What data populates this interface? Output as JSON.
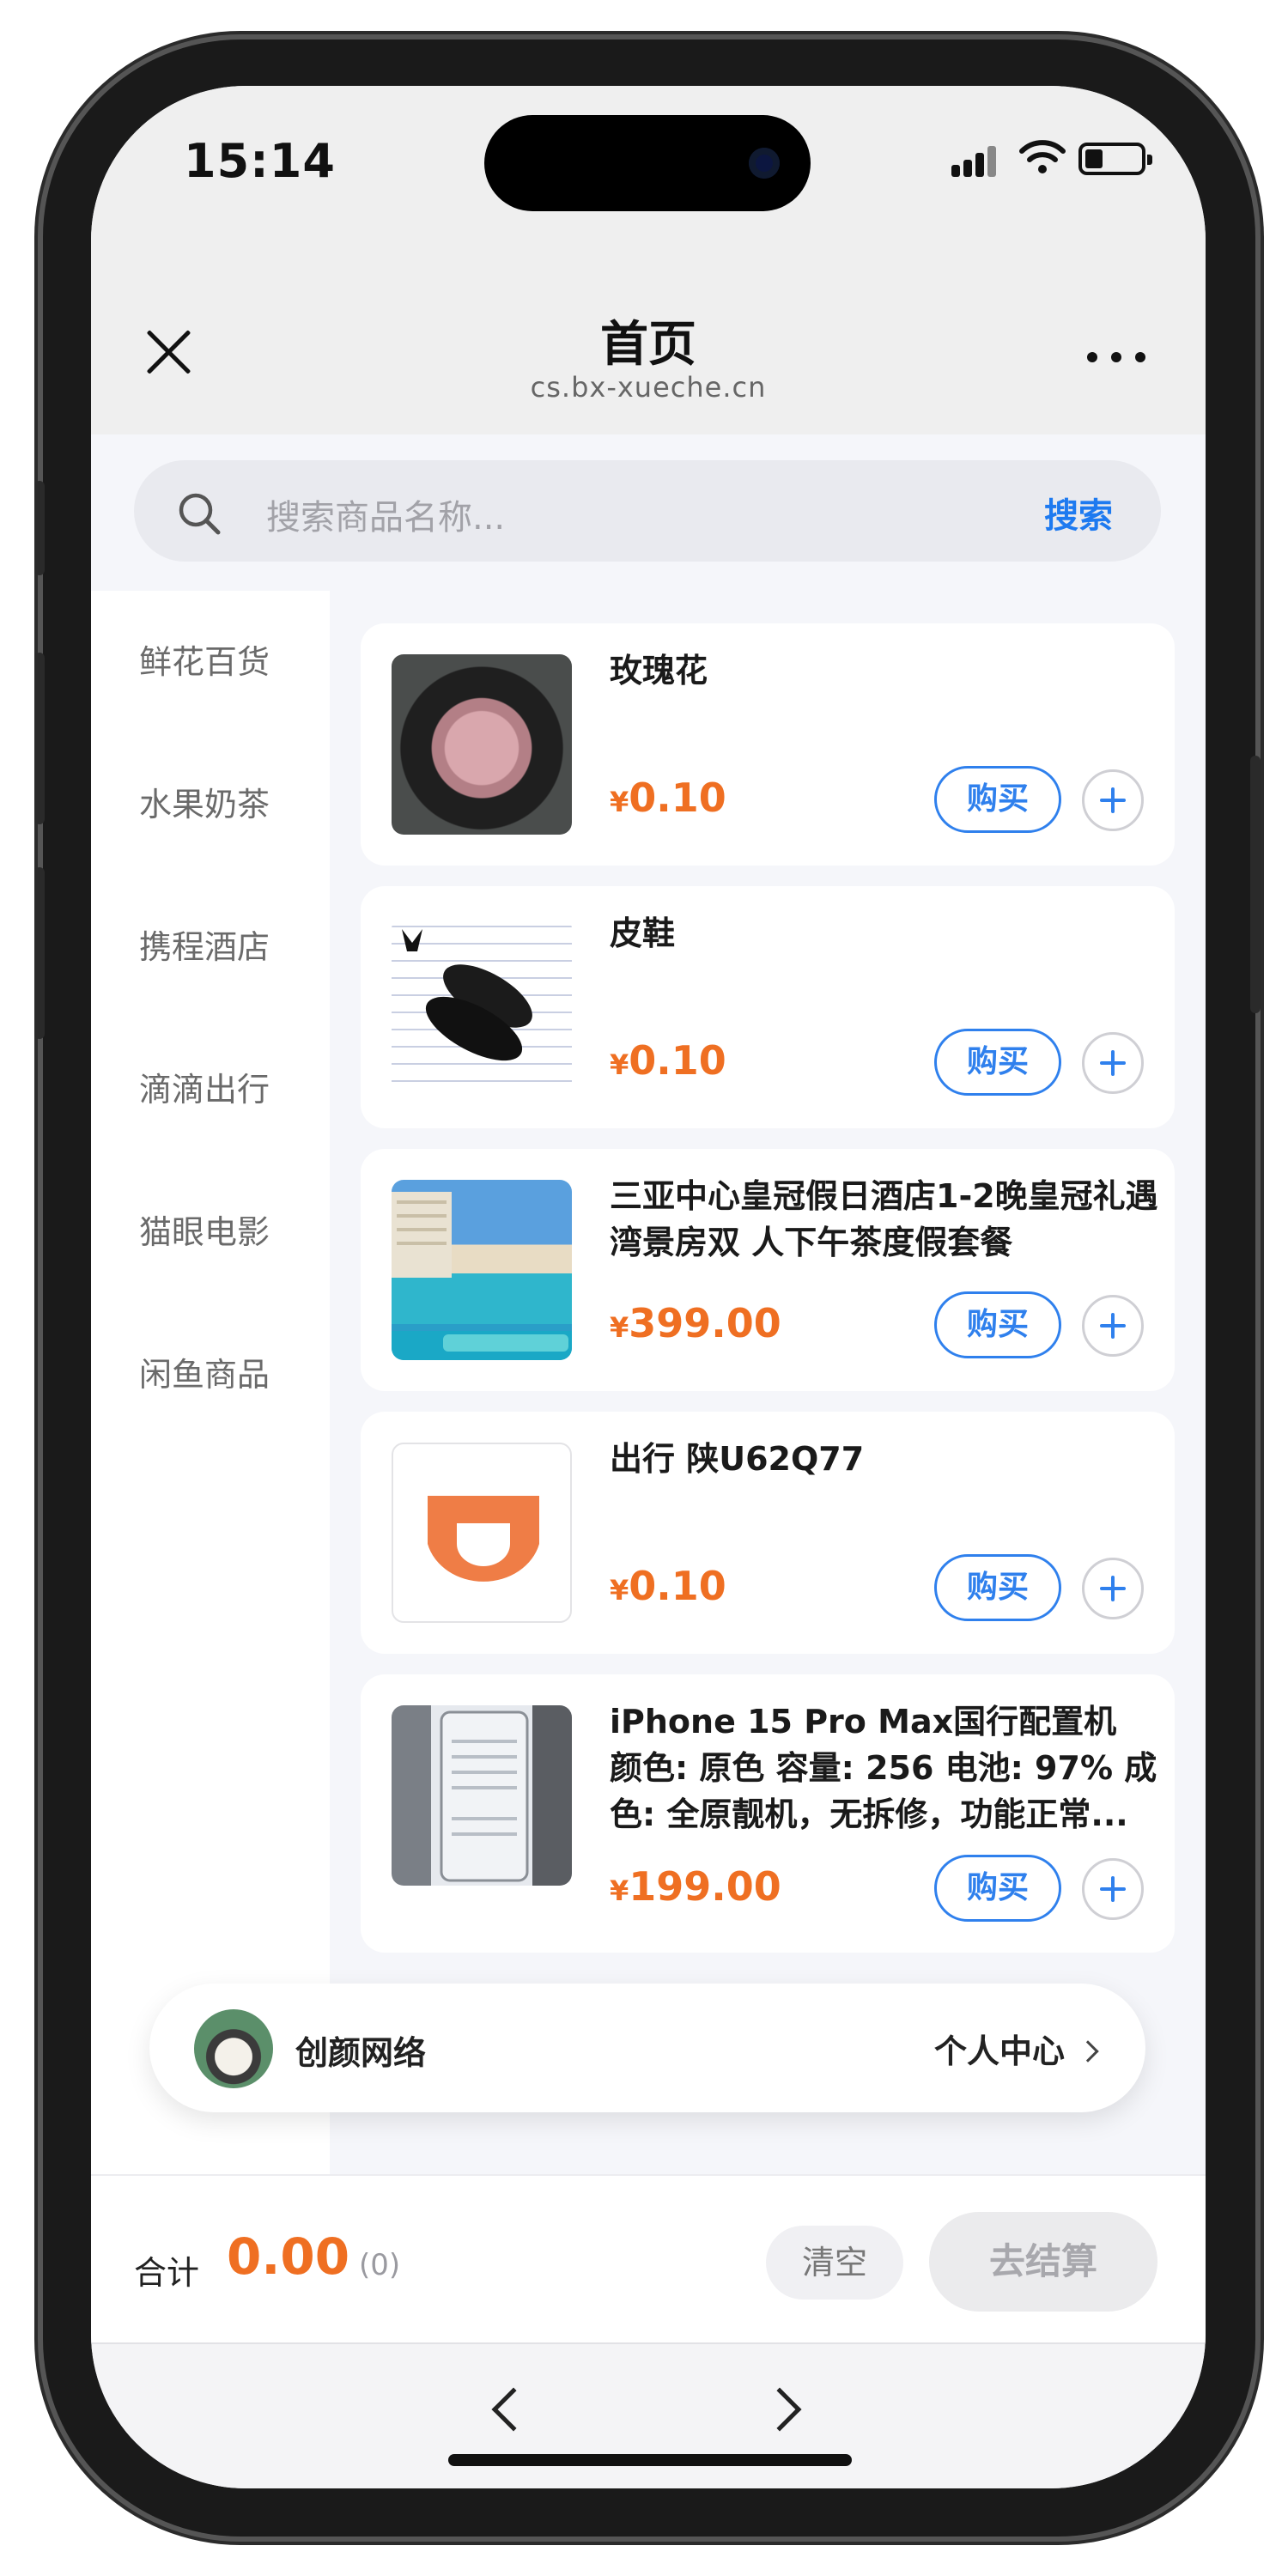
{
  "status_bar": {
    "time": "15:14"
  },
  "header": {
    "title": "首页",
    "url": "cs.bx-xueche.cn"
  },
  "search": {
    "placeholder": "搜索商品名称...",
    "button_label": "搜索"
  },
  "sidebar": {
    "items": [
      {
        "label": "鲜花百货"
      },
      {
        "label": "水果奶茶"
      },
      {
        "label": "携程酒店"
      },
      {
        "label": "滴滴出行"
      },
      {
        "label": "猫眼电影"
      },
      {
        "label": "闲鱼商品"
      }
    ]
  },
  "products": [
    {
      "name": "玫瑰花",
      "currency": "¥",
      "price": "0.10",
      "buy_label": "购买",
      "image": "rose-bouquet"
    },
    {
      "name": "皮鞋",
      "currency": "¥",
      "price": "0.10",
      "buy_label": "购买",
      "image": "leather-shoes"
    },
    {
      "name": "三亚中心皇冠假日酒店1-2晚皇冠礼遇湾景房双 人下午茶度假套餐",
      "currency": "¥",
      "price": "399.00",
      "buy_label": "购买",
      "image": "hotel-pool"
    },
    {
      "name": "出行 陕U62Q77",
      "currency": "¥",
      "price": "0.10",
      "buy_label": "购买",
      "image": "didi-logo"
    },
    {
      "name": "iPhone 15 Pro Max国行配置机 颜色: 原色 容量: 256 电池: 97% 成色: 全原靓机，无拆修，功能正常...",
      "currency": "¥",
      "price": "199.00",
      "buy_label": "购买",
      "image": "iphone-photo"
    }
  ],
  "user_bar": {
    "name": "创颜网络",
    "profile_link": "个人中心"
  },
  "cart": {
    "total_label": "合计",
    "total_value": "0.00",
    "count": "(0)",
    "clear_label": "清空",
    "checkout_label": "去结算"
  },
  "colors": {
    "accent_blue": "#2f80ed",
    "price_orange": "#ef6f22",
    "didi_orange": "#ef7d46"
  }
}
